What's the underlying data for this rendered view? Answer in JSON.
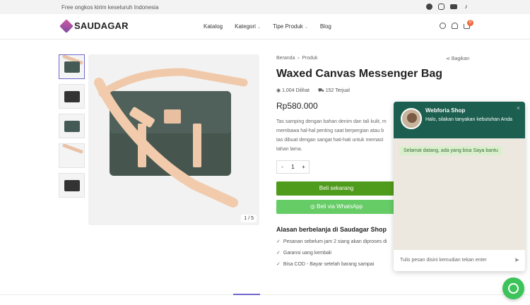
{
  "topbar": {
    "shipping_text": "Free ongkos kirim keseluruh Indonesia",
    "icons": [
      "facebook-icon",
      "instagram-icon",
      "youtube-icon",
      "tiktok-icon"
    ]
  },
  "header": {
    "logo": "SAUDAGAR",
    "nav": [
      "Katalog",
      "Kategori",
      "Tipe Produk",
      "Blog"
    ],
    "cart_count": "0"
  },
  "gallery": {
    "counter": "1 / 5",
    "thumb_count": 5
  },
  "product": {
    "breadcrumb": [
      "Beranda",
      "Produk"
    ],
    "share_label": "Bagikan",
    "title": "Waxed Canvas Messenger Bag",
    "views": "1.004 Dilihat",
    "sold": "152 Terjual",
    "price": "Rp580.000",
    "description_lines": [
      "Tas samping dengan bahan denim dan tali kulit, m",
      "membawa hal-hal penting saat berpergian atau b",
      "tas dibuat dengan sangat hati-hati untuk memast",
      "tahan lama."
    ],
    "qty_minus": "-",
    "qty_value": "1",
    "qty_plus": "+",
    "buy_label": "Beli sekarang",
    "wa_label": "Beli via WhatsApp"
  },
  "reasons": {
    "title": "Alasan berbelanja di Saudagar Shop",
    "items": [
      "Pesanan sebelum jam 2 siang akan diproses di",
      "Garansi uang kembali",
      "Bisa COD - Bayar setelah barang sampai"
    ]
  },
  "chat": {
    "name": "Webforia Shop",
    "subtitle": "Halo, silakan tanyakan kebutuhan Anda",
    "close": "×",
    "message": "Selamat datang, ada yang bisa Saya bantu",
    "input_placeholder": "Tulis pesan disini kemudian tekan enter"
  },
  "colors": {
    "accent": "#6f68c9",
    "buy": "#4f9b1b",
    "whatsapp": "#66cc66",
    "chat_header": "#1c5e4f"
  }
}
